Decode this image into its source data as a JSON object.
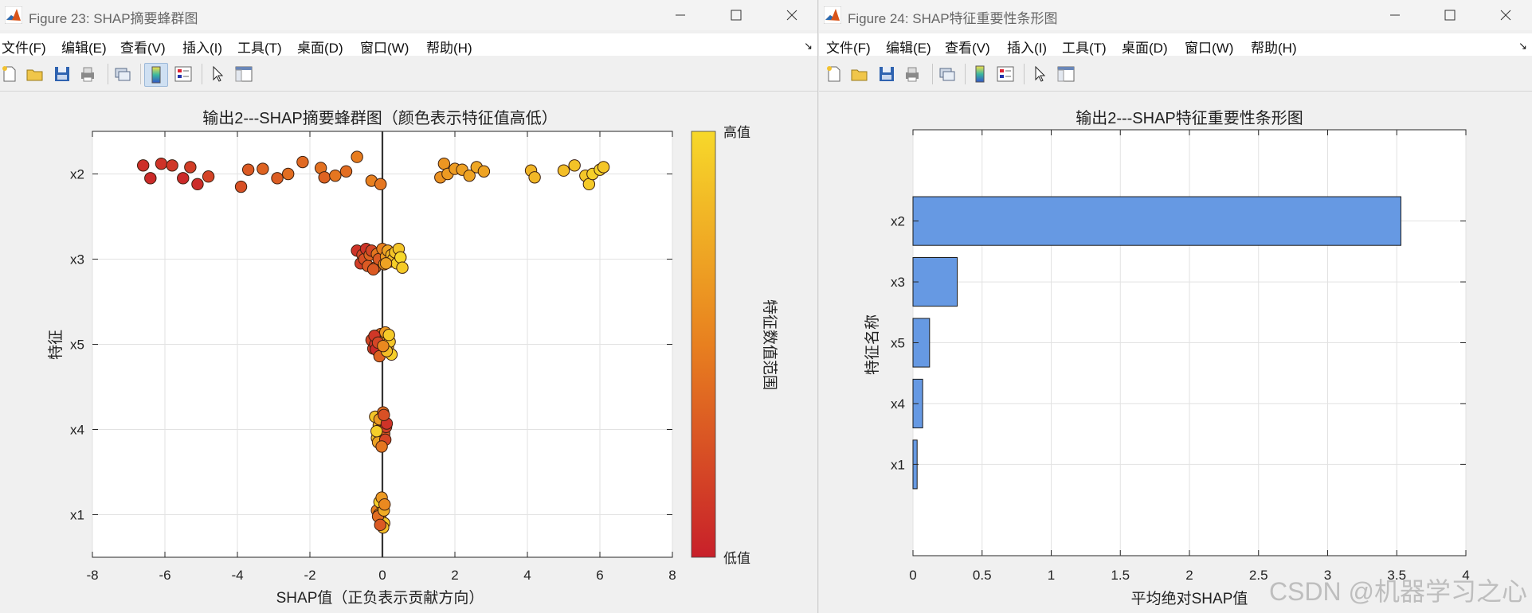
{
  "window1": {
    "title": "Figure 23: SHAP摘要蜂群图",
    "menu": [
      "文件(F)",
      "编辑(E)",
      "查看(V)",
      "插入(I)",
      "工具(T)",
      "桌面(D)",
      "窗口(W)",
      "帮助(H)"
    ]
  },
  "window2": {
    "title": "Figure 24: SHAP特征重要性条形图",
    "menu": [
      "文件(F)",
      "编辑(E)",
      "查看(V)",
      "插入(I)",
      "工具(T)",
      "桌面(D)",
      "窗口(W)",
      "帮助(H)"
    ]
  },
  "colors": {
    "low": "#c8202a",
    "mid": "#e8801f",
    "high": "#f7d82a",
    "bar_fill": "#6699e3",
    "grid": "#e2e2e2"
  },
  "chart_data": [
    {
      "type": "scatter",
      "title": "输出2---SHAP摘要蜂群图（颜色表示特征值高低）",
      "xlabel": "SHAP值（正负表示贡献方向）",
      "ylabel": "特征",
      "xlim": [
        -8,
        8
      ],
      "xticks": [
        "-8",
        "-6",
        "-4",
        "-2",
        "0",
        "2",
        "4",
        "6",
        "8"
      ],
      "categories": [
        "x2",
        "x3",
        "x5",
        "x4",
        "x1"
      ],
      "colorbar": {
        "label": "特征数值范围",
        "high_label": "高值",
        "low_label": "低值"
      },
      "grid": true,
      "series": [
        {
          "feature": "x2",
          "x": [
            -6.6,
            -6.4,
            -6.1,
            -5.8,
            -5.5,
            -5.3,
            -5.1,
            -4.8,
            -3.9,
            -3.7,
            -3.3,
            -2.9,
            -2.6,
            -2.2,
            -1.7,
            -1.6,
            -1.3,
            -1.0,
            -0.7,
            -0.3,
            -0.05,
            1.6,
            1.7,
            1.8,
            2.0,
            2.2,
            2.4,
            2.6,
            2.8,
            4.1,
            4.2,
            5.0,
            5.3,
            5.6,
            5.7,
            5.8,
            6.0,
            6.1
          ],
          "v": [
            0.08,
            0.05,
            0.1,
            0.12,
            0.05,
            0.15,
            0.06,
            0.18,
            0.25,
            0.3,
            0.35,
            0.32,
            0.4,
            0.38,
            0.42,
            0.35,
            0.45,
            0.4,
            0.48,
            0.5,
            0.45,
            0.6,
            0.62,
            0.65,
            0.66,
            0.68,
            0.7,
            0.72,
            0.7,
            0.8,
            0.82,
            0.85,
            0.88,
            0.9,
            0.92,
            0.95,
            0.97,
            0.9
          ],
          "y": [
            0.1,
            -0.05,
            0.12,
            0.1,
            -0.05,
            0.08,
            -0.12,
            -0.03,
            -0.15,
            0.05,
            0.06,
            -0.05,
            0.0,
            0.14,
            0.07,
            -0.04,
            -0.02,
            0.03,
            0.2,
            -0.08,
            -0.12,
            -0.04,
            0.12,
            0.0,
            0.06,
            0.05,
            -0.02,
            0.08,
            0.03,
            0.04,
            -0.04,
            0.04,
            0.1,
            -0.02,
            -0.12,
            0.0,
            0.05,
            0.08
          ]
        },
        {
          "feature": "x3",
          "x": [
            -0.7,
            -0.6,
            -0.55,
            -0.5,
            -0.45,
            -0.4,
            -0.35,
            -0.3,
            -0.2,
            -0.15,
            -0.1,
            0.0,
            0.05,
            0.1,
            0.15,
            0.2,
            0.25,
            0.3,
            0.35,
            0.4,
            0.45,
            0.5,
            0.55,
            -0.25,
            0.1
          ],
          "v": [
            0.1,
            0.15,
            0.2,
            0.25,
            0.1,
            0.3,
            0.35,
            0.2,
            0.4,
            0.45,
            0.3,
            0.5,
            0.6,
            0.65,
            0.7,
            0.75,
            0.8,
            0.85,
            0.9,
            0.95,
            0.9,
            1.0,
            0.92,
            0.3,
            0.7
          ],
          "y": [
            0.1,
            -0.05,
            0.05,
            0.0,
            0.12,
            -0.08,
            0.05,
            0.1,
            -0.1,
            0.06,
            0.0,
            0.12,
            -0.06,
            0.03,
            0.1,
            -0.03,
            0.05,
            0.0,
            0.08,
            -0.05,
            0.12,
            0.02,
            -0.1,
            -0.12,
            -0.05
          ]
        },
        {
          "feature": "x5",
          "x": [
            -0.3,
            -0.25,
            -0.2,
            -0.15,
            -0.1,
            -0.05,
            0.0,
            0.05,
            0.1,
            0.15,
            0.2,
            0.25,
            -0.18,
            -0.08,
            0.08,
            -0.22,
            0.12,
            -0.12,
            0.02,
            0.18
          ],
          "v": [
            0.2,
            0.15,
            0.1,
            0.3,
            0.25,
            0.4,
            0.5,
            0.6,
            0.7,
            0.8,
            0.9,
            0.95,
            0.05,
            0.35,
            0.65,
            0.12,
            0.85,
            0.2,
            0.55,
            0.92
          ],
          "y": [
            0.05,
            -0.05,
            0.0,
            0.1,
            -0.1,
            0.12,
            0.02,
            0.05,
            0.08,
            -0.04,
            0.03,
            -0.12,
            -0.06,
            -0.14,
            0.14,
            0.1,
            -0.08,
            0.02,
            -0.02,
            0.11
          ]
        },
        {
          "feature": "x4",
          "x": [
            -0.2,
            -0.15,
            -0.1,
            -0.05,
            0.0,
            0.05,
            0.1,
            -0.12,
            0.02,
            0.08,
            -0.08,
            0.12,
            -0.02,
            0.04,
            -0.16
          ],
          "v": [
            0.9,
            0.85,
            0.8,
            0.6,
            0.5,
            0.3,
            0.15,
            0.7,
            0.4,
            0.2,
            0.65,
            0.1,
            0.45,
            0.25,
            0.95
          ],
          "y": [
            0.15,
            -0.1,
            0.05,
            0.0,
            0.1,
            -0.05,
            0.03,
            -0.15,
            0.2,
            -0.12,
            0.12,
            0.07,
            -0.2,
            0.17,
            -0.02
          ]
        },
        {
          "feature": "x1",
          "x": [
            -0.15,
            -0.1,
            -0.05,
            0.0,
            0.05,
            -0.08,
            0.02,
            -0.12,
            0.04,
            -0.02,
            -0.06,
            0.06
          ],
          "v": [
            0.5,
            0.6,
            0.7,
            0.8,
            0.9,
            0.95,
            0.85,
            0.4,
            0.75,
            0.65,
            0.3,
            0.55
          ],
          "y": [
            0.05,
            0.0,
            -0.05,
            0.1,
            -0.1,
            0.15,
            -0.15,
            -0.02,
            0.05,
            0.2,
            -0.12,
            0.12
          ]
        }
      ]
    },
    {
      "type": "bar",
      "orientation": "horizontal",
      "title": "输出2---SHAP特征重要性条形图",
      "xlabel": "平均绝对SHAP值",
      "ylabel": "特征名称",
      "xlim": [
        0,
        4
      ],
      "xticks": [
        "0",
        "0.5",
        "1",
        "1.5",
        "2",
        "2.5",
        "3",
        "3.5",
        "4"
      ],
      "categories": [
        "x2",
        "x3",
        "x5",
        "x4",
        "x1"
      ],
      "values": [
        3.53,
        0.32,
        0.12,
        0.07,
        0.03
      ],
      "grid": true
    }
  ],
  "watermark": "CSDN @机器学习之心"
}
